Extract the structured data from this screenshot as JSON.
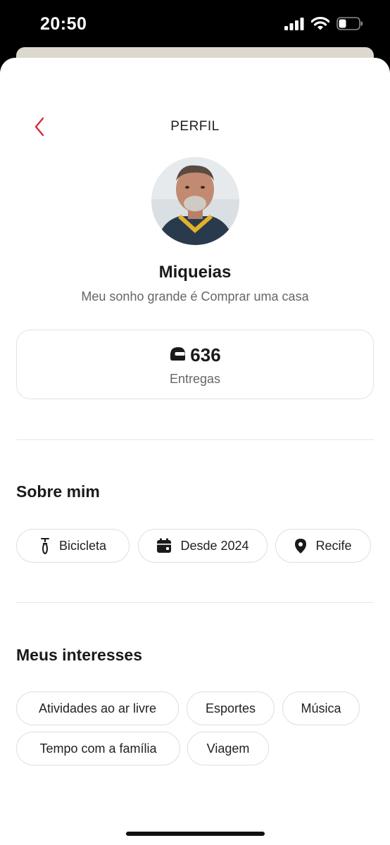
{
  "status_bar": {
    "time": "20:50",
    "icons": [
      "cellular-signal-icon",
      "wifi-icon",
      "battery-icon"
    ]
  },
  "header": {
    "title": "PERFIL",
    "back_icon": "chevron-left-icon",
    "accent_color": "#d8283c"
  },
  "profile": {
    "name": "Miqueias",
    "bio": "Meu sonho grande é Comprar uma casa",
    "avatar": "user-photo"
  },
  "stats": {
    "icon": "helmet-icon",
    "value": "636",
    "label": "Entregas"
  },
  "about": {
    "title": "Sobre mim",
    "chips": [
      {
        "label": "Bicicleta",
        "icon": "bicycle-icon"
      },
      {
        "label": "Desde 2024",
        "icon": "calendar-icon"
      },
      {
        "label": "Recife",
        "icon": "location-pin-icon"
      }
    ]
  },
  "interests": {
    "title": "Meus interesses",
    "chips": [
      {
        "label": "Atividades ao ar livre"
      },
      {
        "label": "Esportes"
      },
      {
        "label": "Música"
      },
      {
        "label": "Tempo com a família"
      },
      {
        "label": "Viagem"
      }
    ]
  }
}
